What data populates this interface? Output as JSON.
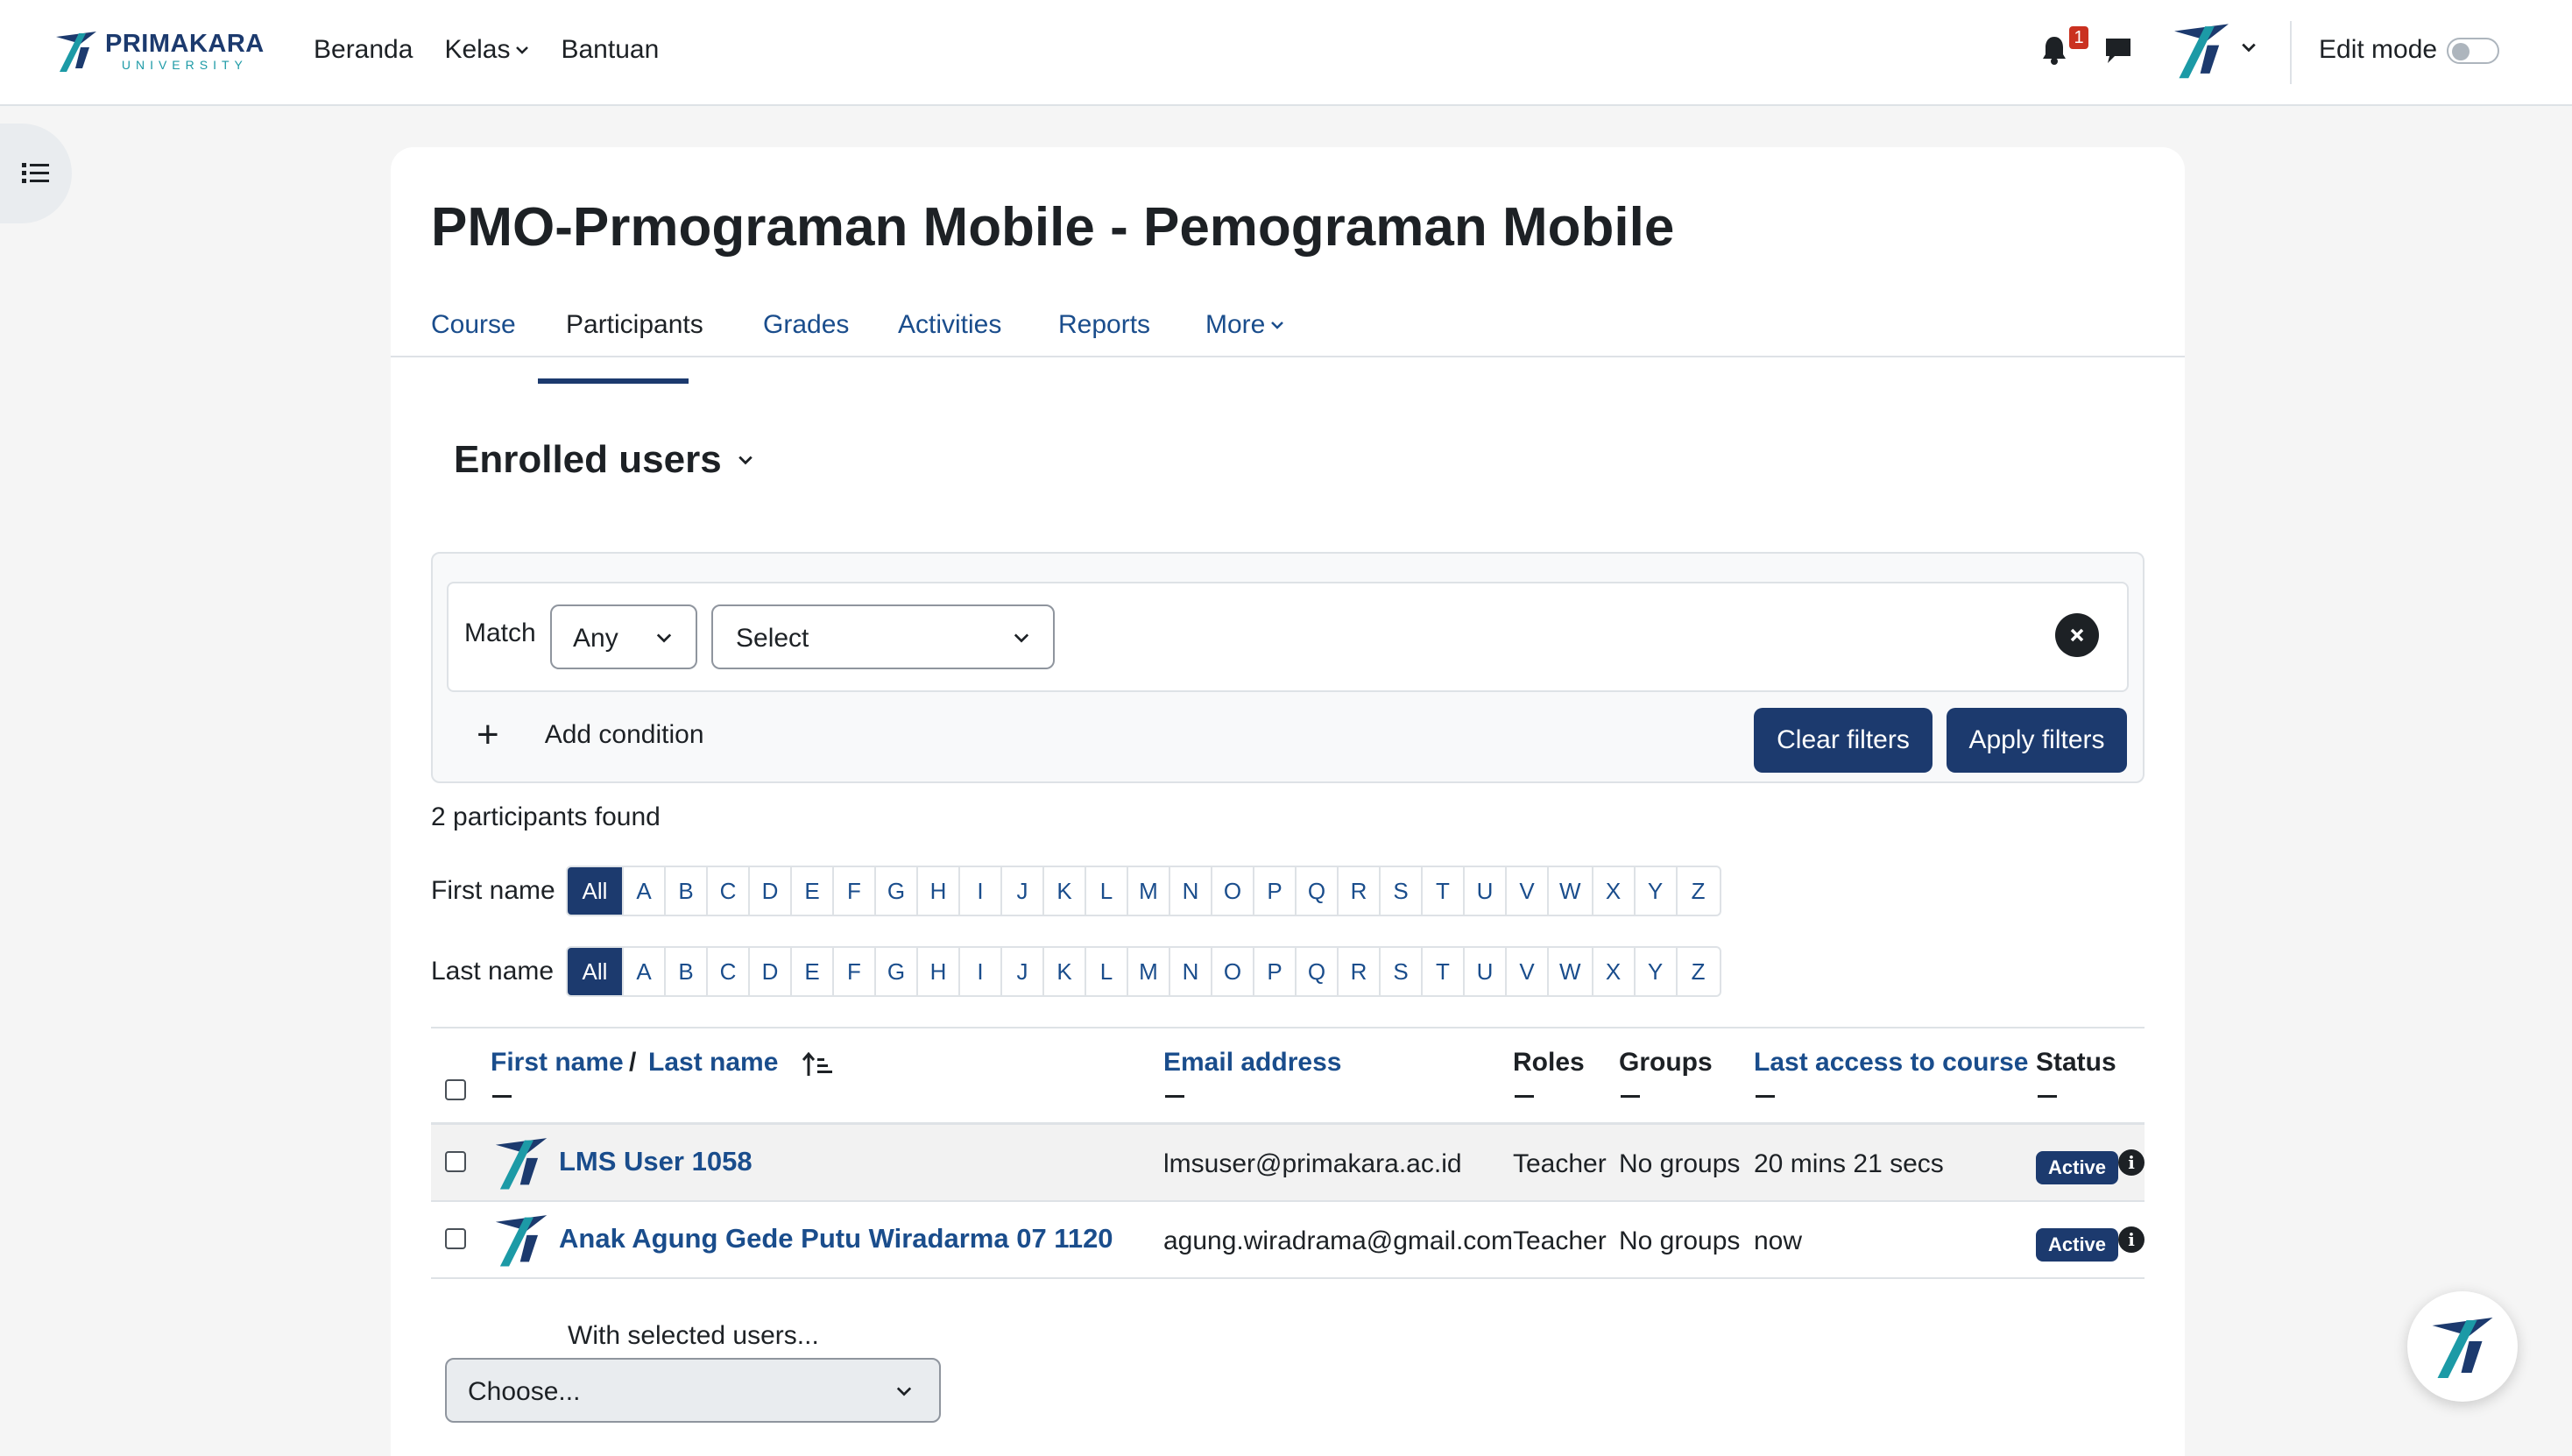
{
  "brand": {
    "name": "PRIMAKARA",
    "sub": "UNIVERSITY"
  },
  "nav": {
    "links": [
      "Beranda",
      "Kelas",
      "Bantuan"
    ]
  },
  "notifications": {
    "count": "1"
  },
  "edit_mode": {
    "label": "Edit mode",
    "on": false
  },
  "page": {
    "title": "PMO-Prmograman Mobile - Pemograman Mobile"
  },
  "tabs": [
    "Course",
    "Participants",
    "Grades",
    "Activities",
    "Reports",
    "More"
  ],
  "active_tab": "Participants",
  "section": {
    "title": "Enrolled users"
  },
  "filter": {
    "match_label": "Match",
    "match_value": "Any",
    "select_value": "Select",
    "add_condition": "Add condition",
    "clear_filters": "Clear filters",
    "apply_filters": "Apply filters"
  },
  "participants_found": "2 participants found",
  "initials": {
    "first_label": "First name",
    "last_label": "Last name",
    "all": "All",
    "letters": [
      "A",
      "B",
      "C",
      "D",
      "E",
      "F",
      "G",
      "H",
      "I",
      "J",
      "K",
      "L",
      "M",
      "N",
      "O",
      "P",
      "Q",
      "R",
      "S",
      "T",
      "U",
      "V",
      "W",
      "X",
      "Y",
      "Z"
    ]
  },
  "table": {
    "headers": {
      "first_name": "First name",
      "separator": "/",
      "last_name": "Last name",
      "email": "Email address",
      "roles": "Roles",
      "groups": "Groups",
      "last_access": "Last access to course",
      "status": "Status"
    },
    "rows": [
      {
        "name": "LMS User 1058",
        "email": "lmsuser@primakara.ac.id",
        "role": "Teacher",
        "groups": "No groups",
        "last_access": "20 mins 21 secs",
        "status": "Active"
      },
      {
        "name": "Anak Agung Gede Putu Wiradarma 07 1120",
        "email": "agung.wiradrama@gmail.com",
        "role": "Teacher",
        "groups": "No groups",
        "last_access": "now",
        "status": "Active"
      }
    ]
  },
  "bulk": {
    "label": "With selected users...",
    "choose": "Choose..."
  },
  "colors": {
    "primary": "#1c3a6e",
    "link": "#1a4d8c",
    "teal": "#1c9aa6",
    "danger": "#ca3120"
  }
}
